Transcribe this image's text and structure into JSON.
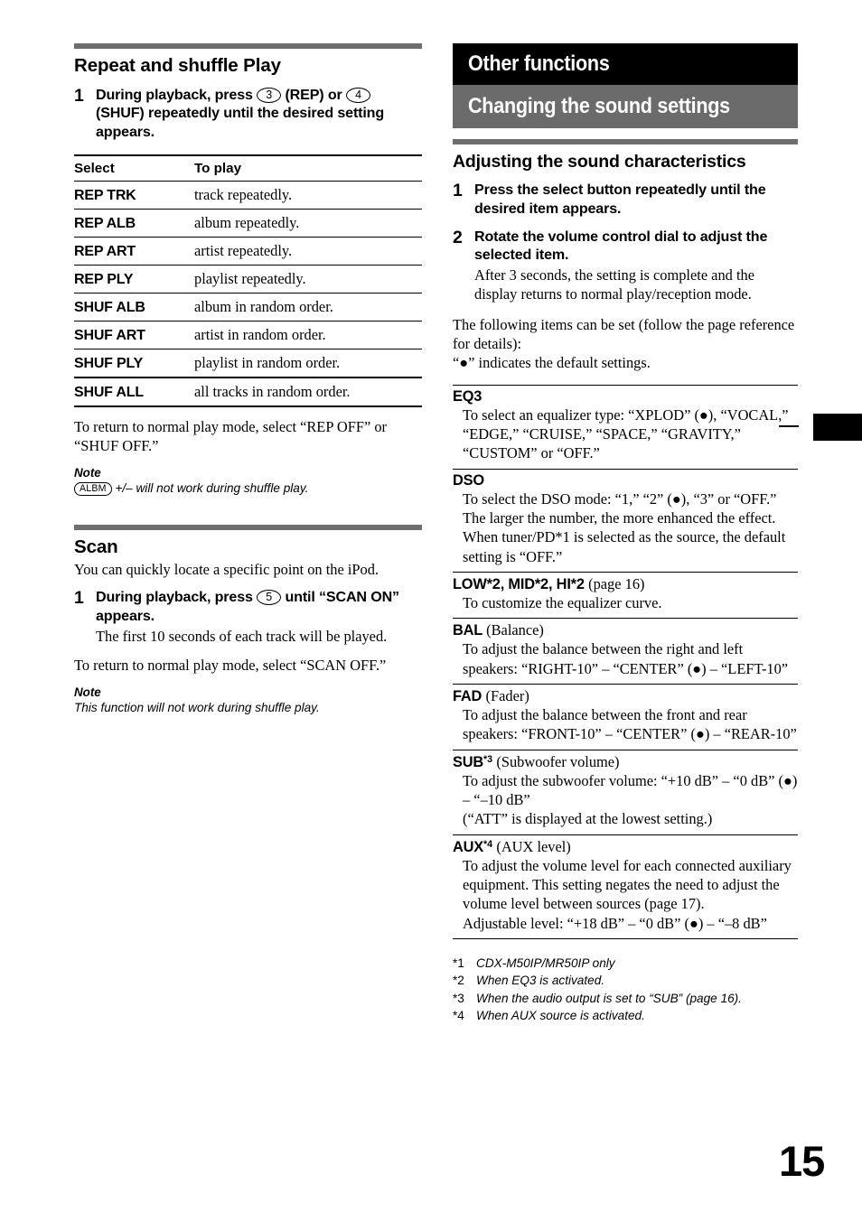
{
  "left_column": {
    "section1": {
      "title": "Repeat and shuffle Play",
      "step1": {
        "num": "1",
        "text_a": "During playback, press",
        "key_a": "3",
        "text_b": "(REP) or",
        "key_b": "4",
        "text_c": "(SHUF) repeatedly until the desired setting appears."
      },
      "table": {
        "headers": [
          "Select",
          "To play"
        ],
        "rows": [
          [
            "REP TRK",
            "track repeatedly."
          ],
          [
            "REP ALB",
            "album repeatedly."
          ],
          [
            "REP ART",
            "artist repeatedly."
          ],
          [
            "REP PLY",
            "playlist repeatedly."
          ],
          [
            "SHUF ALB",
            "album in random order."
          ],
          [
            "SHUF ART",
            "artist in random order."
          ],
          [
            "SHUF PLY",
            "playlist in random order."
          ],
          [
            "SHUF ALL",
            "all tracks in random order."
          ]
        ]
      },
      "after_table": "To return to normal play mode, select “REP OFF” or “SHUF OFF.”",
      "note_label": "Note",
      "note_badge": "ALBM",
      "note_text": "+/– will not work during shuffle play."
    },
    "section2": {
      "title": "Scan",
      "intro": "You can quickly locate a specific point on the iPod.",
      "step1": {
        "num": "1",
        "text_a": "During playback, press",
        "key_a": "5",
        "text_b": "until “SCAN ON” appears.",
        "sub": "The first 10 seconds of each track will be played."
      },
      "after": "To return to normal play mode, select “SCAN OFF.”",
      "note_label": "Note",
      "note_text": "This function will not work during shuffle play."
    }
  },
  "right_column": {
    "chapter_banner": "Other functions",
    "section_banner": "Changing the sound settings",
    "subsection_title": "Adjusting the sound characteristics",
    "steps": [
      {
        "num": "1",
        "head": "Press the select button repeatedly until the desired item appears.",
        "sub": ""
      },
      {
        "num": "2",
        "head": "Rotate the volume control dial to adjust the selected item.",
        "sub": "After 3 seconds, the setting is complete and the display returns to normal play/reception mode."
      }
    ],
    "intro_paragraph": "The following items can be set (follow the page reference for details):",
    "default_note": "“●” indicates the default settings.",
    "items": [
      {
        "name": "EQ3",
        "sup": "",
        "paren": "",
        "desc": "To select an equalizer type: “XPLOD” (●), “VOCAL,” “EDGE,” “CRUISE,” “SPACE,” “GRAVITY,” “CUSTOM” or “OFF.”"
      },
      {
        "name": "DSO",
        "sup": "",
        "paren": "",
        "desc": "To select the DSO mode: “1,” “2” (●), “3” or “OFF.” The larger the number, the more enhanced the effect.\nWhen tuner/PD*1 is selected as the source, the default setting is “OFF.”"
      },
      {
        "name": "LOW*2, MID*2, HI*2",
        "sup": "",
        "paren": "(page 16)",
        "desc": "To customize the equalizer curve."
      },
      {
        "name": "BAL",
        "sup": "",
        "paren": "(Balance)",
        "desc": "To adjust the balance between the right and left speakers: “RIGHT-10” – “CENTER” (●) – “LEFT-10”"
      },
      {
        "name": "FAD",
        "sup": "",
        "paren": "(Fader)",
        "desc": "To adjust the balance between the front and rear speakers: “FRONT-10” – “CENTER” (●) – “REAR-10”"
      },
      {
        "name": "SUB",
        "sup": "*3",
        "paren": "(Subwoofer volume)",
        "desc": "To adjust the subwoofer volume: “+10 dB” – “0 dB” (●) – “–10 dB”\n(“ATT” is displayed at the lowest setting.)"
      },
      {
        "name": "AUX",
        "sup": "*4",
        "paren": "(AUX level)",
        "desc": "To adjust the volume level for each connected auxiliary equipment. This setting negates the need to adjust the volume level between sources (page 17).\nAdjustable level: “+18 dB” – “0 dB” (●) – “–8 dB”"
      }
    ],
    "footnotes": [
      {
        "mark": "*1",
        "text": "CDX-M50IP/MR50IP only"
      },
      {
        "mark": "*2",
        "text": "When EQ3 is activated."
      },
      {
        "mark": "*3",
        "text": "When the audio output is set to “SUB” (page 16)."
      },
      {
        "mark": "*4",
        "text": "When AUX source is activated."
      }
    ]
  },
  "page_number": "15",
  "colors": {
    "banner_black": "#000000",
    "banner_gray": "#6b6b6b",
    "rule_gray": "#6e6e6e"
  }
}
